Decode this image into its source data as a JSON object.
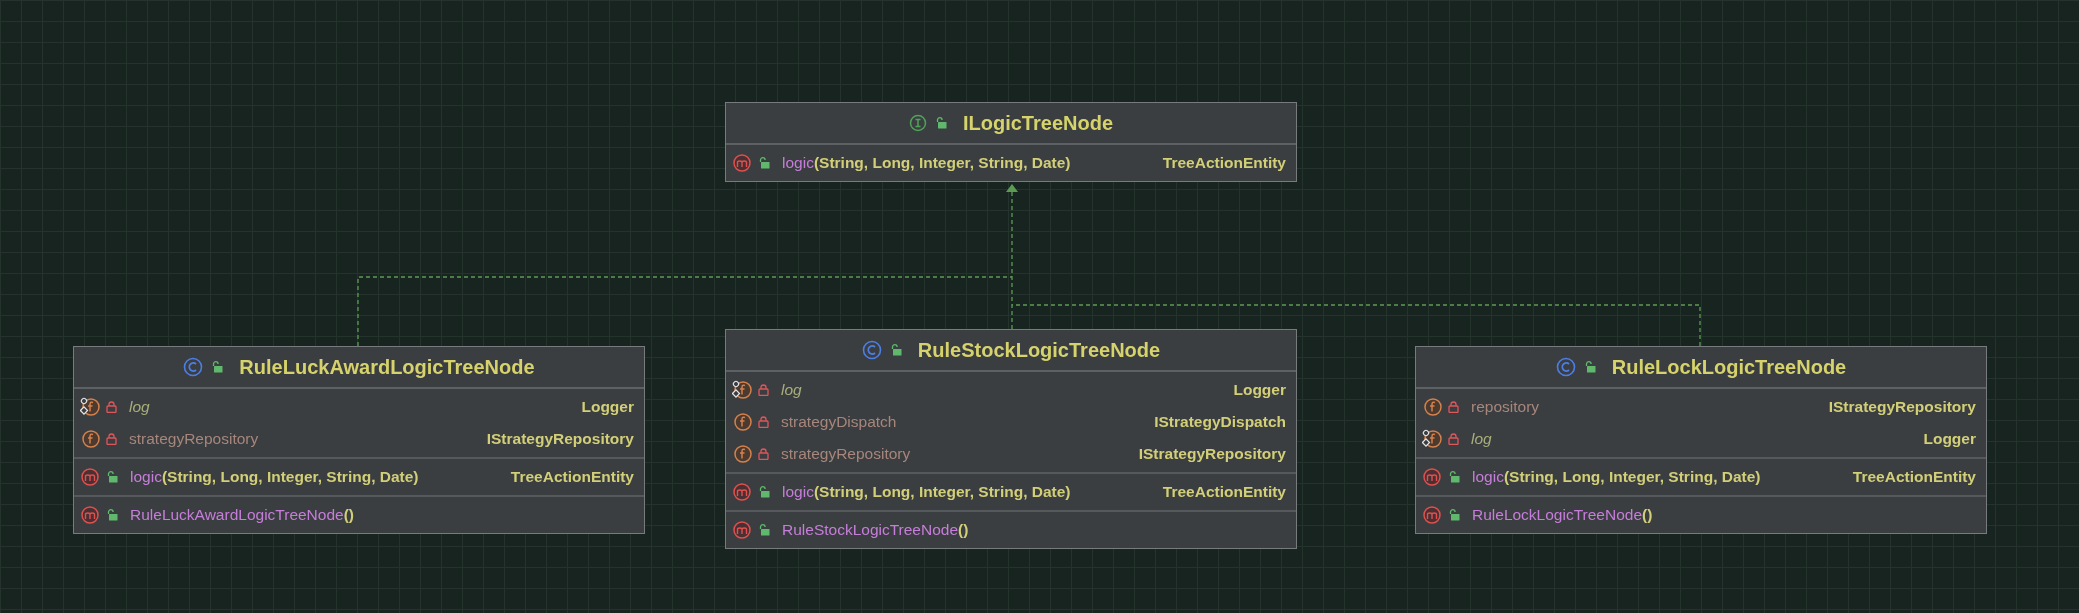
{
  "diagram": {
    "nodes": [
      {
        "kind": "interface",
        "private": false,
        "name": "ILogicTreeNode",
        "sections": [
          [
            {
              "kind": "method",
              "private": false,
              "static": false,
              "name": "logic",
              "params": "(String, Long, Integer, String, Date)",
              "type": "TreeActionEntity"
            }
          ]
        ]
      },
      {
        "kind": "class",
        "private": false,
        "name": "RuleLuckAwardLogicTreeNode",
        "sections": [
          [
            {
              "kind": "field",
              "private": true,
              "static": true,
              "name": "log",
              "type": "Logger"
            },
            {
              "kind": "field",
              "private": true,
              "static": false,
              "name": "strategyRepository",
              "type": "IStrategyRepository"
            }
          ],
          [
            {
              "kind": "method",
              "private": false,
              "static": false,
              "name": "logic",
              "params": "(String, Long, Integer, String, Date)",
              "type": "TreeActionEntity"
            }
          ],
          [
            {
              "kind": "method",
              "private": false,
              "static": false,
              "name": "RuleLuckAwardLogicTreeNode",
              "params": "()"
            }
          ]
        ]
      },
      {
        "kind": "class",
        "private": false,
        "name": "RuleStockLogicTreeNode",
        "sections": [
          [
            {
              "kind": "field",
              "private": true,
              "static": true,
              "name": "log",
              "type": "Logger"
            },
            {
              "kind": "field",
              "private": true,
              "static": false,
              "name": "strategyDispatch",
              "type": "IStrategyDispatch"
            },
            {
              "kind": "field",
              "private": true,
              "static": false,
              "name": "strategyRepository",
              "type": "IStrategyRepository"
            }
          ],
          [
            {
              "kind": "method",
              "private": false,
              "static": false,
              "name": "logic",
              "params": "(String, Long, Integer, String, Date)",
              "type": "TreeActionEntity"
            }
          ],
          [
            {
              "kind": "method",
              "private": false,
              "static": false,
              "name": "RuleStockLogicTreeNode",
              "params": "()"
            }
          ]
        ]
      },
      {
        "kind": "class",
        "private": false,
        "name": "RuleLockLogicTreeNode",
        "sections": [
          [
            {
              "kind": "field",
              "private": true,
              "static": false,
              "name": "repository",
              "type": "IStrategyRepository"
            },
            {
              "kind": "field",
              "private": true,
              "static": true,
              "name": "log",
              "type": "Logger"
            }
          ],
          [
            {
              "kind": "method",
              "private": false,
              "static": false,
              "name": "logic",
              "params": "(String, Long, Integer, String, Date)",
              "type": "TreeActionEntity"
            }
          ],
          [
            {
              "kind": "method",
              "private": false,
              "static": false,
              "name": "RuleLockLogicTreeNode",
              "params": "()"
            }
          ]
        ]
      }
    ]
  }
}
